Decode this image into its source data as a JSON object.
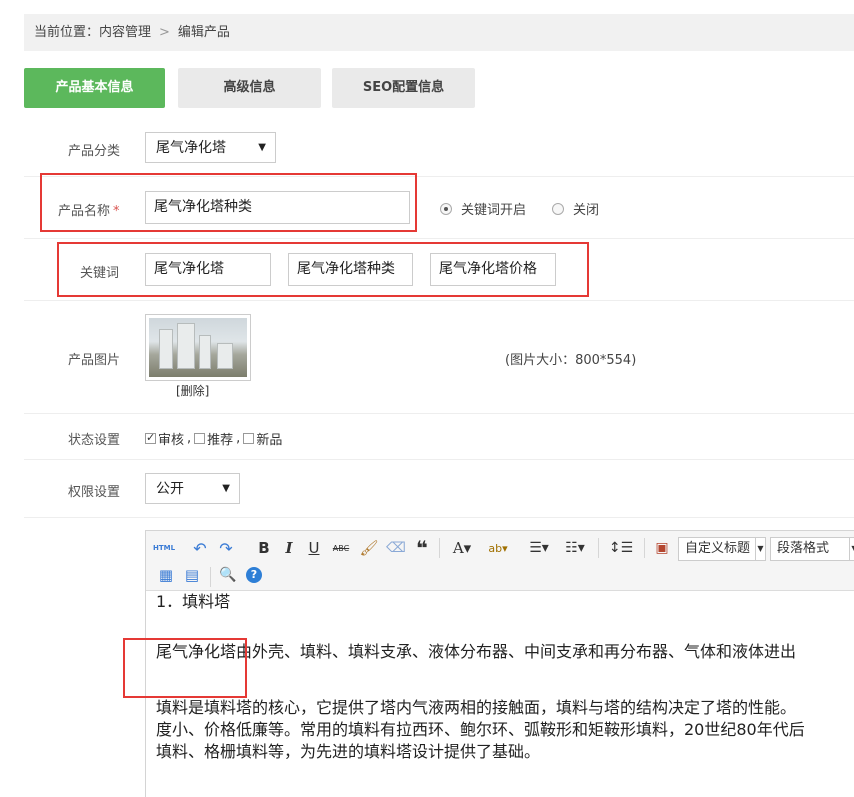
{
  "breadcrumb": {
    "current_label": "当前位置：内容管理",
    "separator": ">",
    "page": "编辑产品"
  },
  "tabs": [
    {
      "label": "产品基本信息",
      "active": true
    },
    {
      "label": "高级信息",
      "active": false
    },
    {
      "label": "SEO配置信息",
      "active": false
    }
  ],
  "form": {
    "category": {
      "label": "产品分类",
      "value": "尾气净化塔"
    },
    "name": {
      "label": "产品名称",
      "required_mark": "*",
      "value": "尾气净化塔种类"
    },
    "keyword_toggle": {
      "on_label": "关键词开启",
      "off_label": "关闭",
      "selected": "on"
    },
    "keywords": {
      "label": "关键词",
      "values": [
        "尾气净化塔",
        "尾气净化塔种类",
        "尾气净化塔价格"
      ]
    },
    "image": {
      "label": "产品图片",
      "delete_label": "[删除]",
      "size_note": "(图片大小：800*554)"
    },
    "status": {
      "label": "状态设置",
      "options": [
        {
          "label": "审核",
          "checked": true
        },
        {
          "label": "推荐",
          "checked": false
        },
        {
          "label": "新品",
          "checked": false
        }
      ],
      "separator": ","
    },
    "permission": {
      "label": "权限设置",
      "value": "公开"
    }
  },
  "editor": {
    "toolbar": {
      "html_label": "HTML",
      "bold": "B",
      "italic": "I",
      "underline": "U",
      "strike": "ABC",
      "custom_heading": "自定义标题",
      "paragraph_format": "段落格式"
    },
    "content": {
      "heading": "1．填料塔",
      "para1": "尾气净化塔由外壳、填料、填料支承、液体分布器、中间支承和再分布器、气体和液体进出",
      "para2_line1": "填料是填料塔的核心，它提供了塔内气液两相的接触面，填料与塔的结构决定了塔的性能。",
      "para2_line2": "度小、价格低廉等。常用的填料有拉西环、鲍尔环、弧鞍形和矩鞍形填料，20世纪80年代后",
      "para2_line3": "填料、格栅填料等，为先进的填料塔设计提供了基础。"
    }
  },
  "colors": {
    "active_tab": "#5cb85c",
    "highlight_box": "#e53935",
    "required": "#d9534f"
  }
}
